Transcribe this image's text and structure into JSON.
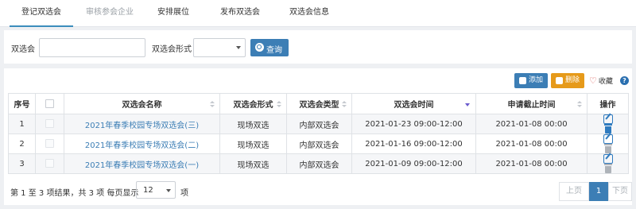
{
  "tabs": [
    {
      "label": "登记双选会",
      "state": "active"
    },
    {
      "label": "审核参会企业",
      "state": "disabled"
    },
    {
      "label": "安排展位",
      "state": "normal"
    },
    {
      "label": "发布双选会",
      "state": "normal"
    },
    {
      "label": "双选会信息",
      "state": "normal"
    }
  ],
  "search": {
    "name_label": "双选会",
    "name_value": "",
    "form_label": "双选会形式",
    "form_value": "",
    "query_label": "查询",
    "query_icon": "search-icon"
  },
  "toolbar": {
    "add_label": "添加",
    "add_icon": "plus-icon",
    "delete_label": "删除",
    "delete_icon": "trash-icon",
    "fav_label": "收藏",
    "fav_icon": "heart-icon",
    "help_label": "?",
    "add_color": "#3c7eb5",
    "delete_color": "#e69a1a"
  },
  "table": {
    "headers": {
      "index": "序号",
      "name": "双选会名称",
      "form": "双选会形式",
      "type": "双选会类型",
      "time": "双选会时间",
      "deadline": "申请截止时间",
      "ops": "操作"
    },
    "rows": [
      {
        "index": "1",
        "name": "2021年春季校园专场双选会(三)",
        "form": "现场双选",
        "type": "内部双选会",
        "time": "2021-01-23 09:00-12:00",
        "deadline": "2021-01-08 00:00"
      },
      {
        "index": "2",
        "name": "2021年春季校园专场双选会(二)",
        "form": "现场双选",
        "type": "内部双选会",
        "time": "2021-01-16 09:00-12:00",
        "deadline": "2021-01-08 00:00"
      },
      {
        "index": "3",
        "name": "2021年春季校园专场双选会(一)",
        "form": "现场双选",
        "type": "内部双选会",
        "time": "2021-01-09 09:00-12:00",
        "deadline": "2021-01-08 00:00"
      }
    ]
  },
  "footer": {
    "info": "第 1 至 3 项结果，共 3 项  每页显示",
    "page_size": "12",
    "unit": "项",
    "prev": "上页",
    "current": "1",
    "next": "下页"
  }
}
